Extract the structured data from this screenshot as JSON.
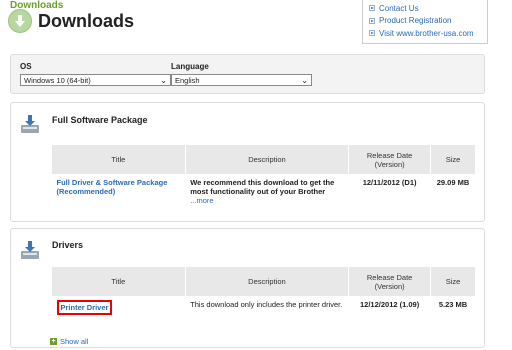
{
  "header": {
    "breadcrumb": "Downloads",
    "title": "Downloads"
  },
  "links": [
    {
      "label": "Contact Us"
    },
    {
      "label": "Product Registration"
    },
    {
      "label": "Visit www.brother-usa.com"
    }
  ],
  "filters": {
    "os_label": "OS",
    "os_value": "Windows 10 (64-bit)",
    "lang_label": "Language",
    "lang_value": "English"
  },
  "sections": [
    {
      "title": "Full Software Package",
      "columns": {
        "title": "Title",
        "description": "Description",
        "release": "Release Date\n(Version)",
        "size": "Size"
      },
      "row": {
        "title": "Full Driver & Software Package (Recommended)",
        "description": "We recommend this download to get the most functionality out of your Brother",
        "more": "...more",
        "release": "12/11/2012 (D1)",
        "size": "29.09 MB"
      }
    },
    {
      "title": "Drivers",
      "columns": {
        "title": "Title",
        "description": "Description",
        "release": "Release Date\n(Version)",
        "size": "Size"
      },
      "row": {
        "title": "Printer Driver",
        "description": "This download only includes the printer driver.",
        "release": "12/12/2012 (1.09)",
        "size": "5.23 MB"
      }
    }
  ],
  "footer": {
    "show_all": "Show all"
  }
}
